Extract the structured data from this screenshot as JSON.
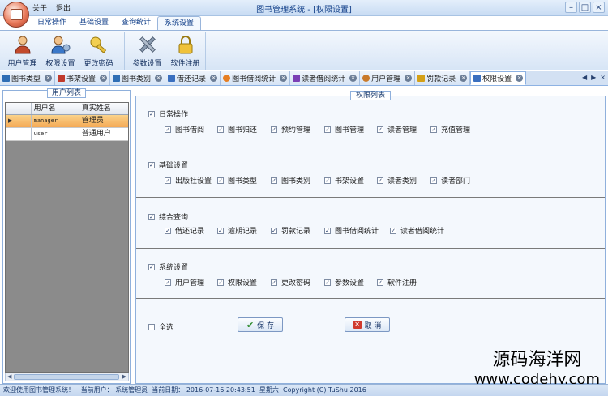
{
  "app": {
    "title": "图书管理系统 - [权限设置]"
  },
  "quick_menu": [
    "关于",
    "退出"
  ],
  "window_controls": [
    "minimize-icon",
    "maximize-icon",
    "close-icon"
  ],
  "ribbon_tabs": [
    "日常操作",
    "基础设置",
    "查询统计",
    "系统设置"
  ],
  "ribbon_active_tab": "系统设置",
  "ribbon_groups": [
    {
      "buttons": [
        {
          "label": "用户管理",
          "icon": "user-icon"
        },
        {
          "label": "权限设置",
          "icon": "permission-icon"
        },
        {
          "label": "更改密码",
          "icon": "key-icon"
        }
      ]
    },
    {
      "buttons": [
        {
          "label": "参数设置",
          "icon": "tools-icon"
        },
        {
          "label": "软件注册",
          "icon": "lock-icon"
        }
      ]
    }
  ],
  "doc_tabs": [
    {
      "label": "图书类型",
      "icon": "book-type-icon",
      "color": "#2f6eb5"
    },
    {
      "label": "书架设置",
      "icon": "bookshelf-icon",
      "color": "#c0392b"
    },
    {
      "label": "图书类别",
      "icon": "book-category-icon",
      "color": "#2f6eb5"
    },
    {
      "label": "借还记录",
      "icon": "record-icon",
      "color": "#3a6fbf"
    },
    {
      "label": "图书借阅统计",
      "icon": "pie-chart-icon",
      "color": "#e67e22"
    },
    {
      "label": "读者借阅统计",
      "icon": "chart-icon",
      "color": "#7b3fb5"
    },
    {
      "label": "用户管理",
      "icon": "user-icon",
      "color": "#c97a2b"
    },
    {
      "label": "罚款记录",
      "icon": "money-icon",
      "color": "#d4a017"
    },
    {
      "label": "权限设置",
      "icon": "permission-icon",
      "color": "#3a6fbf",
      "active": true
    }
  ],
  "users_panel": {
    "title": "用户列表",
    "columns": [
      "用户名",
      "真实姓名"
    ],
    "rows": [
      {
        "username": "manager",
        "realname": "管理员",
        "selected": true
      },
      {
        "username": "user",
        "realname": "普通用户",
        "selected": false
      }
    ]
  },
  "permissions_panel": {
    "title": "权限列表",
    "groups": [
      {
        "name": "日常操作",
        "checked": true,
        "items": [
          "图书借阅",
          "图书归还",
          "预约管理",
          "图书管理",
          "读者管理",
          "充值管理"
        ]
      },
      {
        "name": "基础设置",
        "checked": true,
        "items": [
          "出版社设置",
          "图书类型",
          "图书类别",
          "书架设置",
          "读者类别",
          "读者部门"
        ]
      },
      {
        "name": "综合查询",
        "checked": true,
        "items": [
          "借还记录",
          "逾期记录",
          "罚款记录",
          "图书借阅统计",
          "读者借阅统计"
        ]
      },
      {
        "name": "系统设置",
        "checked": true,
        "items": [
          "用户管理",
          "权限设置",
          "更改密码",
          "参数设置",
          "软件注册"
        ]
      }
    ],
    "select_all": "全选",
    "save_button": "保  存",
    "cancel_button": "取  消"
  },
  "status_bar": {
    "welcome": "欢迎使用图书管理系统！",
    "current_user_label": "当前用户：",
    "current_user": "系统管理员",
    "current_date_label": "当前日期：",
    "current_date": "2016-07-16 20:43:51",
    "weekday": "星期六",
    "copyright": "Copyright (C) TuShu 2016"
  },
  "watermark": {
    "line1": "源码海洋网",
    "line2": "www.codehy.com"
  }
}
